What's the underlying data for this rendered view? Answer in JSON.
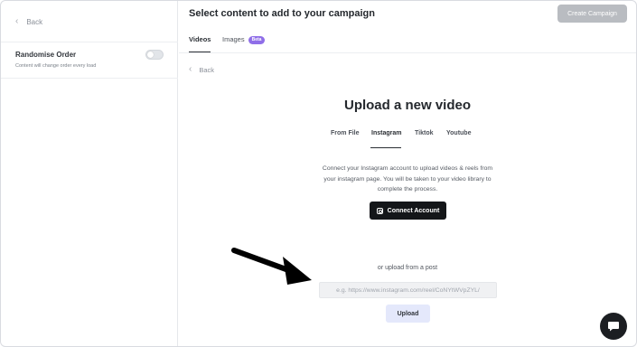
{
  "sidebar": {
    "back_label": "Back",
    "randomise_title": "Randomise Order",
    "randomise_sub": "Content will change order every load",
    "toggle_on": false
  },
  "header": {
    "title": "Select content to add to your campaign",
    "create_button": "Create Campaign",
    "tabs": [
      {
        "label": "Videos",
        "active": true
      },
      {
        "label": "Images",
        "badge": "Beta",
        "active": false
      }
    ]
  },
  "main": {
    "back_label": "Back",
    "upload_title": "Upload a new video",
    "source_tabs": [
      {
        "label": "From File",
        "active": false
      },
      {
        "label": "Instagram",
        "active": true
      },
      {
        "label": "Tiktok",
        "active": false
      },
      {
        "label": "Youtube",
        "active": false
      }
    ],
    "connect_text": "Connect your Instagram account to upload videos & reels from your instagram page. You will be taken to your video library to complete the process.",
    "connect_button": "Connect Account",
    "or_label": "or upload from a post",
    "url_placeholder": "e.g. https://www.instagram.com/reel/CoNYtWVpZYL/",
    "upload_button": "Upload"
  },
  "colors": {
    "accent_badge": "#8f6ee8",
    "primary_dark": "#141619",
    "upload_button_bg": "#e4e8fb",
    "disabled_button": "#b9bcc1"
  },
  "icons": [
    "chevron-left-icon",
    "instagram-icon",
    "arrow-icon",
    "chat-icon"
  ]
}
